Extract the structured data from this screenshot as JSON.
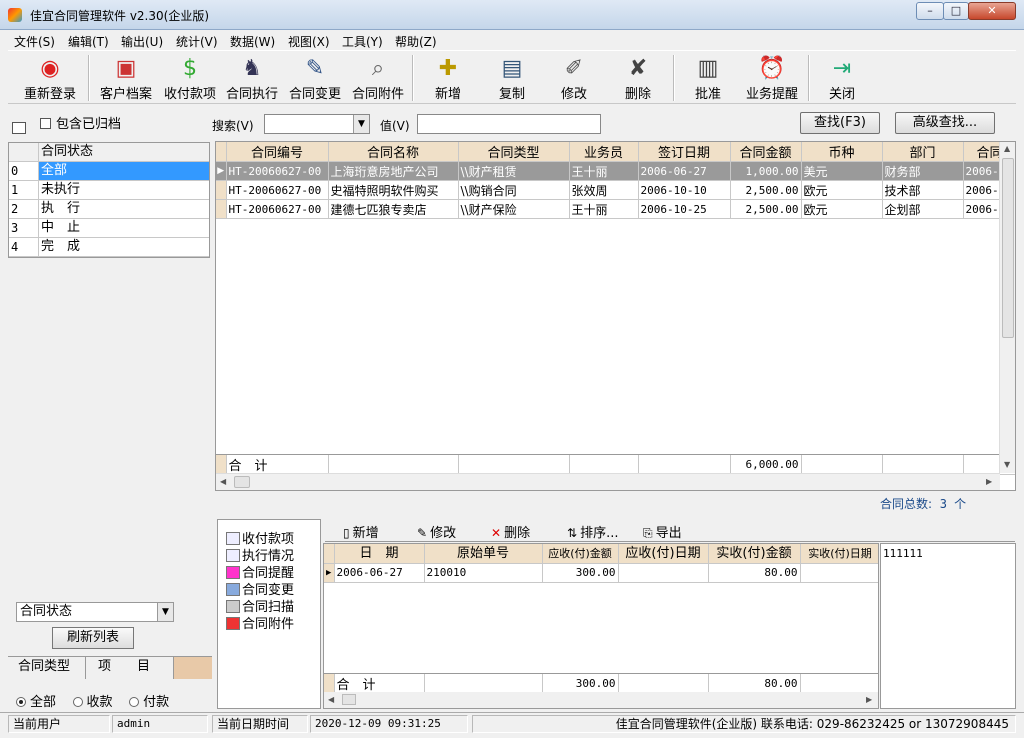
{
  "window": {
    "title": "佳宜合同管理软件 v2.30(企业版)",
    "btn_min": "–",
    "btn_max": "□",
    "btn_close": "✕"
  },
  "menu": [
    "文件(S)",
    "编辑(T)",
    "输出(U)",
    "统计(V)",
    "数据(W)",
    "视图(X)",
    "工具(Y)",
    "帮助(Z)"
  ],
  "toolbar": [
    {
      "label": "重新登录",
      "icon": "login-icon"
    },
    {
      "label": "客户档案",
      "icon": "customer-icon"
    },
    {
      "label": "收付款项",
      "icon": "payment-icon"
    },
    {
      "label": "合同执行",
      "icon": "execute-icon"
    },
    {
      "label": "合同变更",
      "icon": "change-icon"
    },
    {
      "label": "合同附件",
      "icon": "attachment-icon"
    },
    {
      "label": "新增",
      "icon": "add-icon"
    },
    {
      "label": "复制",
      "icon": "copy-icon"
    },
    {
      "label": "修改",
      "icon": "edit-icon"
    },
    {
      "label": "删除",
      "icon": "delete-icon"
    },
    {
      "label": "批准",
      "icon": "approve-icon"
    },
    {
      "label": "业务提醒",
      "icon": "reminder-icon"
    },
    {
      "label": "关闭",
      "icon": "exit-icon"
    }
  ],
  "left": {
    "include_archived": "包含已归档",
    "status_header": "合同状态",
    "statuses": [
      {
        "idx": "0",
        "label": "全部"
      },
      {
        "idx": "1",
        "label": "未执行"
      },
      {
        "idx": "2",
        "label": "执　行"
      },
      {
        "idx": "3",
        "label": "中　止"
      },
      {
        "idx": "4",
        "label": "完　成"
      }
    ],
    "combo_value": "合同状态",
    "refresh": "刷新列表",
    "tab_type": "合同类型",
    "tab_item": "项　　目",
    "radio_all": "全部",
    "radio_receive": "收款",
    "radio_pay": "付款"
  },
  "search": {
    "search_label": "搜索(V)",
    "search_value": "",
    "value_label": "值(V)",
    "value_text": "",
    "find_button": "查找(F3)",
    "advanced_button": "高级查找..."
  },
  "contracts": {
    "columns": [
      "合同编号",
      "合同名称",
      "合同类型",
      "业务员",
      "签订日期",
      "合同金额",
      "币种",
      "部门",
      "合同"
    ],
    "rows": [
      [
        "HT-20060627-00",
        "上海珩意房地产公司",
        "\\\\财产租赁",
        "王十丽",
        "2006-06-27",
        "1,000.00",
        "美元",
        "财务部",
        "2006-"
      ],
      [
        "HT-20060627-00",
        "史福特照明软件购买",
        "\\\\购销合同",
        "张效周",
        "2006-10-10",
        "2,500.00",
        "欧元",
        "技术部",
        "2006-"
      ],
      [
        "HT-20060627-00",
        "建德七匹狼专卖店",
        "\\\\财产保险",
        "王十丽",
        "2006-10-25",
        "2,500.00",
        "欧元",
        "企划部",
        "2006-"
      ]
    ],
    "total_label": "合　计",
    "total_amount": "6,000.00",
    "count_label": "合同总数:",
    "count_value": "3 个"
  },
  "detail_nav": [
    "收付款项",
    "执行情况",
    "合同提醒",
    "合同变更",
    "合同扫描",
    "合同附件"
  ],
  "detail_toolbar": {
    "add": "新增",
    "edit": "修改",
    "delete": "删除",
    "sort": "排序...",
    "export": "导出"
  },
  "payments": {
    "columns": [
      "日　期",
      "原始单号",
      "应收(付)金额",
      "应收(付)日期",
      "实收(付)金额",
      "实收(付)日期"
    ],
    "rows": [
      [
        "2006-06-27",
        "210010",
        "300.00",
        "",
        "80.00",
        ""
      ]
    ],
    "total_label": "合　计",
    "total_due": "300.00",
    "total_paid": "80.00"
  },
  "memo": "111111",
  "status": {
    "user_label": "当前用户",
    "user": "admin",
    "datetime_label": "当前日期时间",
    "datetime": "2020-12-09 09:31:25",
    "info": "佳宜合同管理软件(企业版) 联系电话: 029-86232425 or 13072908445"
  },
  "colors": {
    "selection": "#3399ff",
    "grid_header": "#f0e0c8",
    "selected_row": "#9a9a9a"
  }
}
